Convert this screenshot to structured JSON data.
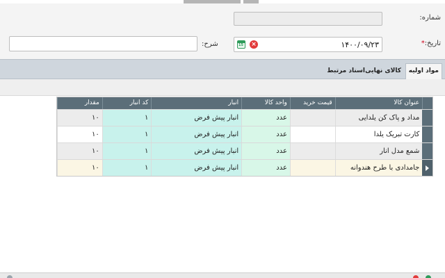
{
  "form": {
    "number_label": "شماره:",
    "number_value": "",
    "date_label": "تاریخ:",
    "date_required_mark": "*",
    "date_value": "۱۴۰۰/۰۹/۲۳",
    "calendar_icon_text": "15",
    "description_label": "شرح:",
    "description_value": ""
  },
  "tabs": [
    {
      "label": "مواد اولیه",
      "active": true
    },
    {
      "label": "کالای نهایی",
      "active": false
    },
    {
      "label": "اسناد مرتبط",
      "active": false
    }
  ],
  "grid": {
    "columns": [
      "عنوان کالا",
      "قیمت خرید",
      "واحد کالا",
      "انبار",
      "کد انبار",
      "مقدار"
    ],
    "rows": [
      {
        "title": "مداد و پاک کن یلدایی",
        "price": "",
        "unit": "عدد",
        "warehouse": "انبار پیش فرض",
        "code": "۱",
        "qty": "۱۰"
      },
      {
        "title": "کارت تبریک یلدا",
        "price": "",
        "unit": "عدد",
        "warehouse": "انبار پیش فرض",
        "code": "۱",
        "qty": "۱۰"
      },
      {
        "title": "شمع مدل انار",
        "price": "",
        "unit": "عدد",
        "warehouse": "انبار پیش فرض",
        "code": "۱",
        "qty": "۱۰"
      },
      {
        "title": "جامدادی با طرح هندوانه",
        "price": "",
        "unit": "عدد",
        "warehouse": "انبار پیش فرض",
        "code": "۱",
        "qty": "۱۰"
      }
    ]
  },
  "colors": {
    "header_bg": "#5b6e79",
    "teal_cell": "#c8f2ec",
    "mint_cell": "#d8f7e8",
    "selected_row": "#fbf6e4",
    "required": "#d0021b"
  }
}
